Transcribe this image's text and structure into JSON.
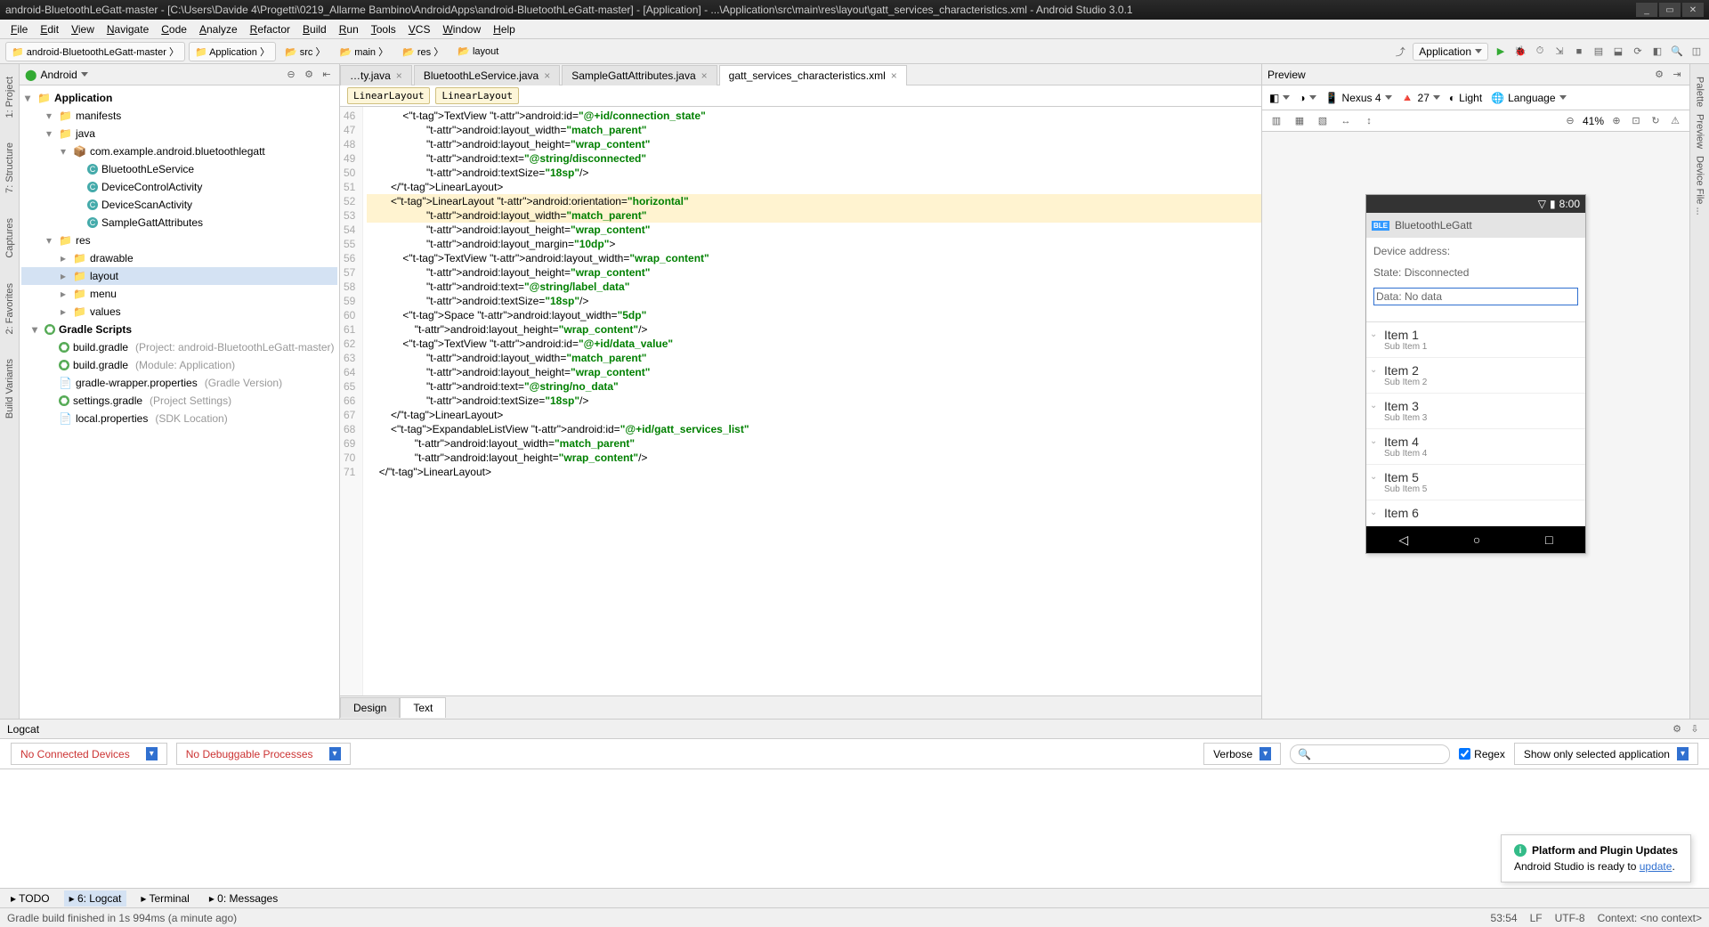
{
  "window": {
    "title": "android-BluetoothLeGatt-master - [C:\\Users\\Davide 4\\Progetti\\0219_Allarme Bambino\\AndroidApps\\android-BluetoothLeGatt-master] - [Application] - ...\\Application\\src\\main\\res\\layout\\gatt_services_characteristics.xml - Android Studio 3.0.1"
  },
  "menu": [
    "File",
    "Edit",
    "View",
    "Navigate",
    "Code",
    "Analyze",
    "Refactor",
    "Build",
    "Run",
    "Tools",
    "VCS",
    "Window",
    "Help"
  ],
  "breadcrumb": [
    "android-BluetoothLeGatt-master",
    "Application",
    "src",
    "main",
    "res",
    "layout"
  ],
  "run_config": "Application",
  "left_tabs": [
    "1: Project",
    "7: Structure",
    "Captures",
    "2: Favorites",
    "Build Variants"
  ],
  "right_tabs": [
    "Palette",
    "Preview",
    "Device File ..."
  ],
  "project": {
    "selector": "Android",
    "tree": {
      "app": "Application",
      "nodes": [
        {
          "d": 1,
          "ar": "▾",
          "ic": "folder",
          "t": "manifests"
        },
        {
          "d": 1,
          "ar": "▾",
          "ic": "folder",
          "t": "java"
        },
        {
          "d": 2,
          "ar": "▾",
          "ic": "pkg",
          "t": "com.example.android.bluetoothlegatt"
        },
        {
          "d": 3,
          "ar": "",
          "ic": "c",
          "t": "BluetoothLeService"
        },
        {
          "d": 3,
          "ar": "",
          "ic": "c",
          "t": "DeviceControlActivity"
        },
        {
          "d": 3,
          "ar": "",
          "ic": "c",
          "t": "DeviceScanActivity"
        },
        {
          "d": 3,
          "ar": "",
          "ic": "c",
          "t": "SampleGattAttributes"
        },
        {
          "d": 1,
          "ar": "▾",
          "ic": "folder",
          "t": "res"
        },
        {
          "d": 2,
          "ar": "▸",
          "ic": "folder",
          "t": "drawable"
        },
        {
          "d": 2,
          "ar": "▸",
          "ic": "folder",
          "t": "layout",
          "sel": true
        },
        {
          "d": 2,
          "ar": "▸",
          "ic": "folder",
          "t": "menu"
        },
        {
          "d": 2,
          "ar": "▸",
          "ic": "folder",
          "t": "values"
        },
        {
          "d": 0,
          "ar": "▾",
          "ic": "g",
          "t": "Gradle Scripts",
          "bold": true
        },
        {
          "d": 1,
          "ar": "",
          "ic": "g",
          "t": "build.gradle",
          "hint": "(Project: android-BluetoothLeGatt-master)"
        },
        {
          "d": 1,
          "ar": "",
          "ic": "g",
          "t": "build.gradle",
          "hint": "(Module: Application)"
        },
        {
          "d": 1,
          "ar": "",
          "ic": "gp",
          "t": "gradle-wrapper.properties",
          "hint": "(Gradle Version)"
        },
        {
          "d": 1,
          "ar": "",
          "ic": "g",
          "t": "settings.gradle",
          "hint": "(Project Settings)"
        },
        {
          "d": 1,
          "ar": "",
          "ic": "gp",
          "t": "local.properties",
          "hint": "(SDK Location)"
        }
      ]
    }
  },
  "editor": {
    "tabs": [
      {
        "label": "ty.java",
        "active": false,
        "partial": true
      },
      {
        "label": "BluetoothLeService.java",
        "active": false
      },
      {
        "label": "SampleGattAttributes.java",
        "active": false
      },
      {
        "label": "gatt_services_characteristics.xml",
        "active": true
      }
    ],
    "bc_tags": [
      "LinearLayout",
      "LinearLayout"
    ],
    "first_line": 46,
    "selected_line": 53,
    "lines": [
      "            <TextView android:id=\"@+id/connection_state\"",
      "                    android:layout_width=\"match_parent\"",
      "                    android:layout_height=\"wrap_content\"",
      "                    android:text=\"@string/disconnected\"",
      "                    android:textSize=\"18sp\"/>",
      "        </LinearLayout>",
      "        <LinearLayout android:orientation=\"horizontal\"",
      "                    android:layout_width=\"match_parent\"",
      "                    android:layout_height=\"wrap_content\"",
      "                    android:layout_margin=\"10dp\">",
      "            <TextView android:layout_width=\"wrap_content\"",
      "                    android:layout_height=\"wrap_content\"",
      "                    android:text=\"@string/label_data\"",
      "                    android:textSize=\"18sp\"/>",
      "            <Space android:layout_width=\"5dp\"",
      "                android:layout_height=\"wrap_content\"/>",
      "            <TextView android:id=\"@+id/data_value\"",
      "                    android:layout_width=\"match_parent\"",
      "                    android:layout_height=\"wrap_content\"",
      "                    android:text=\"@string/no_data\"",
      "                    android:textSize=\"18sp\"/>",
      "        </LinearLayout>",
      "        <ExpandableListView android:id=\"@+id/gatt_services_list\"",
      "                android:layout_width=\"match_parent\"",
      "                android:layout_height=\"wrap_content\"/>",
      "    </LinearLayout>"
    ],
    "design_tabs": [
      "Design",
      "Text"
    ]
  },
  "preview": {
    "title": "Preview",
    "device": "Nexus 4",
    "api": "27",
    "theme": "Light",
    "lang": "Language",
    "zoom": "41%",
    "dev": {
      "time": "8:00",
      "appbar": "BluetoothLeGatt",
      "addr": "Device address:",
      "state": "State: Disconnected",
      "data": "Data: No data",
      "items": [
        {
          "t": "Item 1",
          "s": "Sub Item 1"
        },
        {
          "t": "Item 2",
          "s": "Sub Item 2"
        },
        {
          "t": "Item 3",
          "s": "Sub Item 3"
        },
        {
          "t": "Item 4",
          "s": "Sub Item 4"
        },
        {
          "t": "Item 5",
          "s": "Sub Item 5"
        },
        {
          "t": "Item 6",
          "s": ""
        }
      ]
    }
  },
  "logcat": {
    "title": "Logcat",
    "dev": "No Connected Devices",
    "proc": "No Debuggable Processes",
    "level": "Verbose",
    "search_ph": "",
    "regex": "Regex",
    "regex_checked": true,
    "filter": "Show only selected application"
  },
  "popup": {
    "title": "Platform and Plugin Updates",
    "body_pre": "Android Studio is ready to ",
    "link": "update",
    "body_post": "."
  },
  "bottom_tabs": [
    "TODO",
    "6: Logcat",
    "Terminal",
    "0: Messages"
  ],
  "status": {
    "msg": "Gradle build finished in 1s 994ms (a minute ago)",
    "pos": "53:54",
    "le": "LF",
    "enc": "UTF-8",
    "ctx": "Context: <no context>"
  }
}
